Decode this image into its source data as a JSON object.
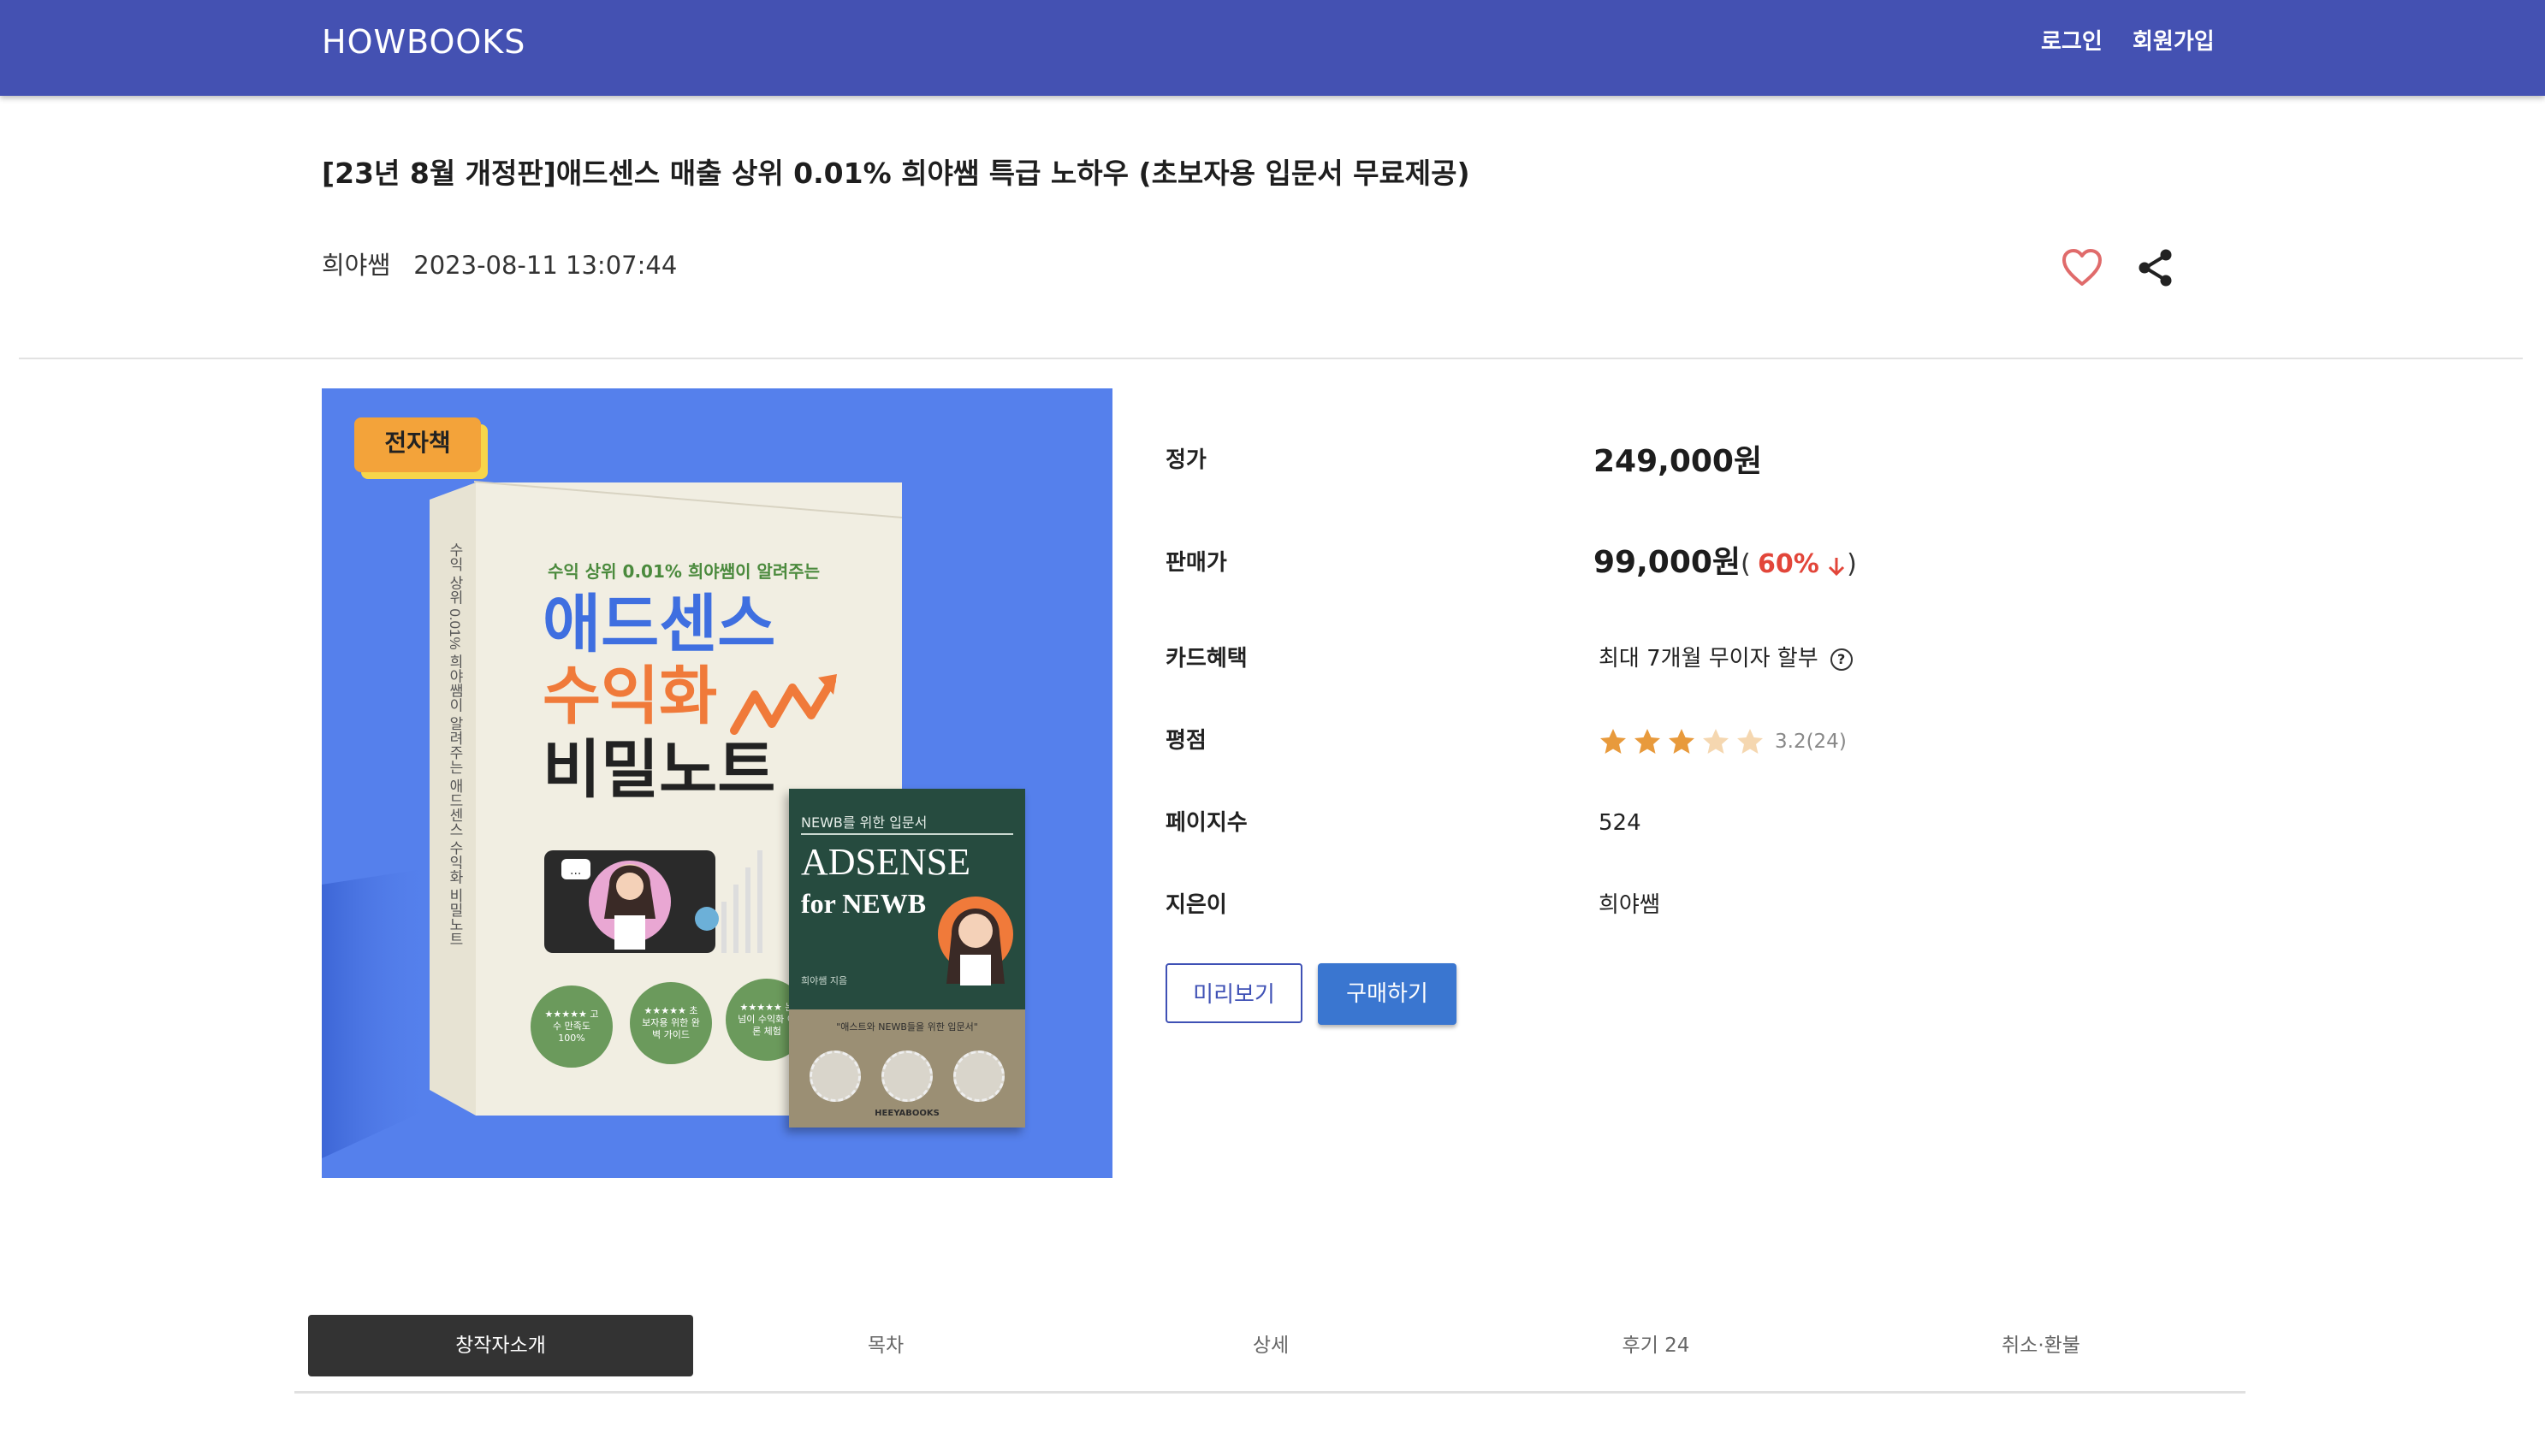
{
  "header": {
    "logo": "HOWBOOKS",
    "login": "로그인",
    "signup": "회원가입"
  },
  "product": {
    "title": "[23년 8월 개정판]애드센스 매출 상위 0.01% 희야쌤 특급 노하우 (초보자용 입문서 무료제공)",
    "author": "희야쌤",
    "datetime": "2023-08-11 13:07:44"
  },
  "cover": {
    "badge": "전자책",
    "main_book": {
      "subtitle": "수익 상위 0.01% 희야쌤이 알려주는",
      "title_line1": "애드센스",
      "title_line2": "수익화",
      "title_line3": "비밀노트",
      "spine": "수익 상위 0.01% 희야쌤이 알려주는 애드센스 수익화 비밀노트",
      "circles": [
        "★★★★★ 고수 만족도 100%",
        "★★★★★ 초보자용 위한 완벽 가이드",
        "★★★★★ 눈넘이 수익화 이론 체험"
      ]
    },
    "small_book": {
      "tag": "NEWB를 위한 입문서",
      "title1": "ADSENSE",
      "title2": "for NEWB",
      "author": "희야쌤 지음",
      "quote": "\"애스트와 NEWB들을 위한 입문서\"",
      "publisher": "HEEYABOOKS"
    }
  },
  "info": {
    "list_price_label": "정가",
    "list_price": "249,000원",
    "sale_price_label": "판매가",
    "sale_price": "99,000원",
    "paren_open": "(",
    "paren_close": ")",
    "discount": "60%",
    "card_label": "카드혜택",
    "card_value": "최대 7개월 무이자 할부",
    "rating_label": "평점",
    "rating": 3.2,
    "rating_text": "3.2(24)",
    "pages_label": "페이지수",
    "pages": "524",
    "author_label": "지은이",
    "author": "희야쌤"
  },
  "actions": {
    "preview": "미리보기",
    "buy": "구매하기"
  },
  "tabs": [
    "창작자소개",
    "목차",
    "상세",
    "후기 24",
    "취소·환불"
  ],
  "active_tab": 0,
  "icons": [
    "heart-outline-icon",
    "share-icon",
    "help-circle-icon",
    "star-icon",
    "arrow-down-icon"
  ],
  "colors": {
    "header": "#4451b2",
    "cover_bg": "#5580ec",
    "discount": "#e2463a",
    "buy_button": "#3a76d0",
    "preview_border": "#3f51b5",
    "star_filled": "#e89a3c",
    "star_empty": "#f5d7b0",
    "active_tab": "#333333"
  }
}
